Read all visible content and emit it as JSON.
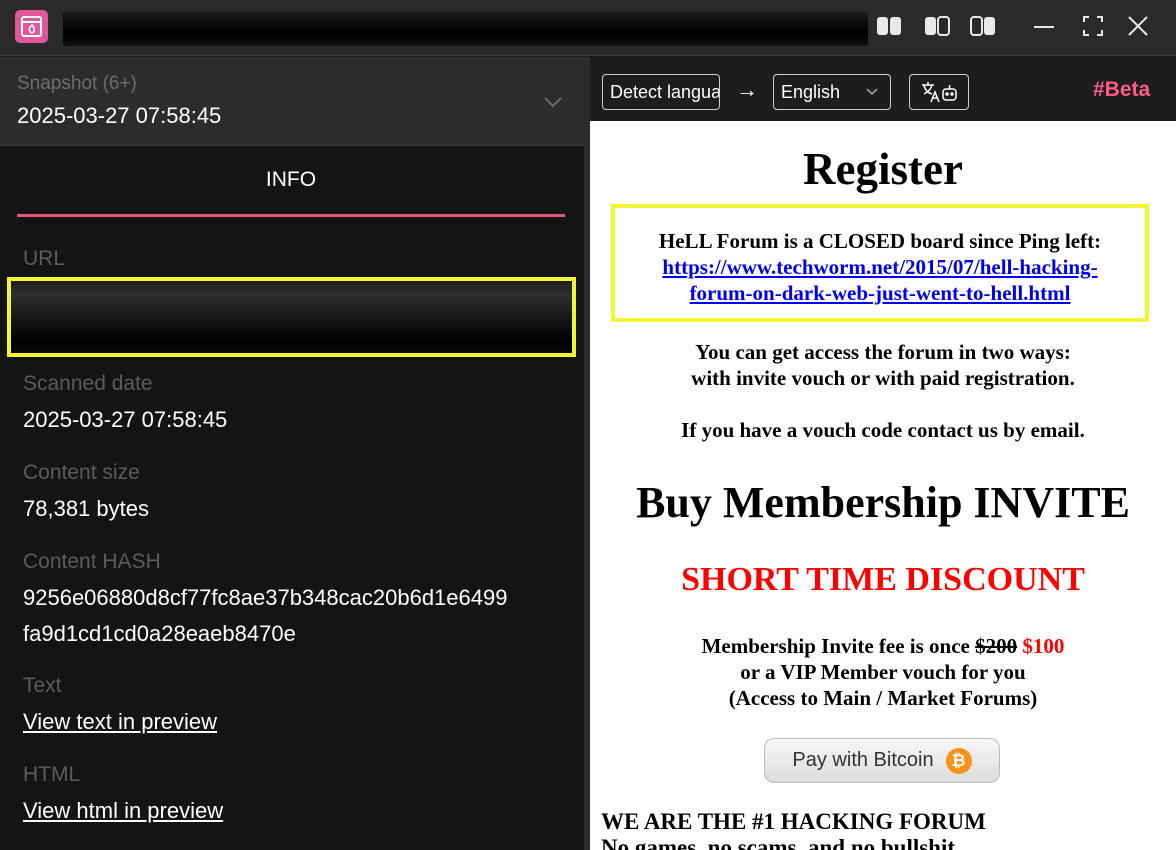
{
  "left": {
    "snapshot": {
      "label": "Snapshot (6+)",
      "value": "2025-03-27 07:58:45"
    },
    "tab": "INFO",
    "fields": {
      "url_label": "URL",
      "scanned_label": "Scanned date",
      "scanned_value": "2025-03-27 07:58:45",
      "size_label": "Content size",
      "size_value": "78,381 bytes",
      "hash_label": "Content HASH",
      "hash_line1": "9256e06880d8cf77fc8ae37b348cac20b6d1e6499",
      "hash_line2": "fa9d1cd1cd0a28eaeb8470e",
      "text_label": "Text",
      "text_link": "View text in preview",
      "html_label": "HTML",
      "html_link": "View html in preview"
    }
  },
  "translate": {
    "source": "Detect langua",
    "arrow": "→",
    "target": "English",
    "beta": "#Beta"
  },
  "page": {
    "register": "Register",
    "closed_text": "HeLL Forum is a CLOSED board since Ping left:",
    "closed_link": "https://www.techworm.net/2015/07/hell-hacking-forum-on-dark-web-just-went-to-hell.html",
    "access1": "You can get access the forum in two ways:",
    "access2": "with invite vouch or with paid registration.",
    "vouch": "If you have a vouch code contact us by email.",
    "buy": "Buy Membership INVITE",
    "discount": "SHORT TIME DISCOUNT",
    "fee_prefix": "Membership Invite fee is once ",
    "fee_old": "$200",
    "fee_new": "$100",
    "fee_line2": "or a VIP Member vouch for you",
    "fee_line3": "(Access to Main / Market Forums)",
    "pay_button": "Pay with Bitcoin",
    "btc_symbol": "₿",
    "ad1": "WE ARE THE #1 HACKING FORUM",
    "ad2": "No games, no scams, and no bullshit"
  },
  "colors": {
    "accent": "#e8577a",
    "highlight": "#f2f533",
    "beta": "#ff5a8a"
  }
}
